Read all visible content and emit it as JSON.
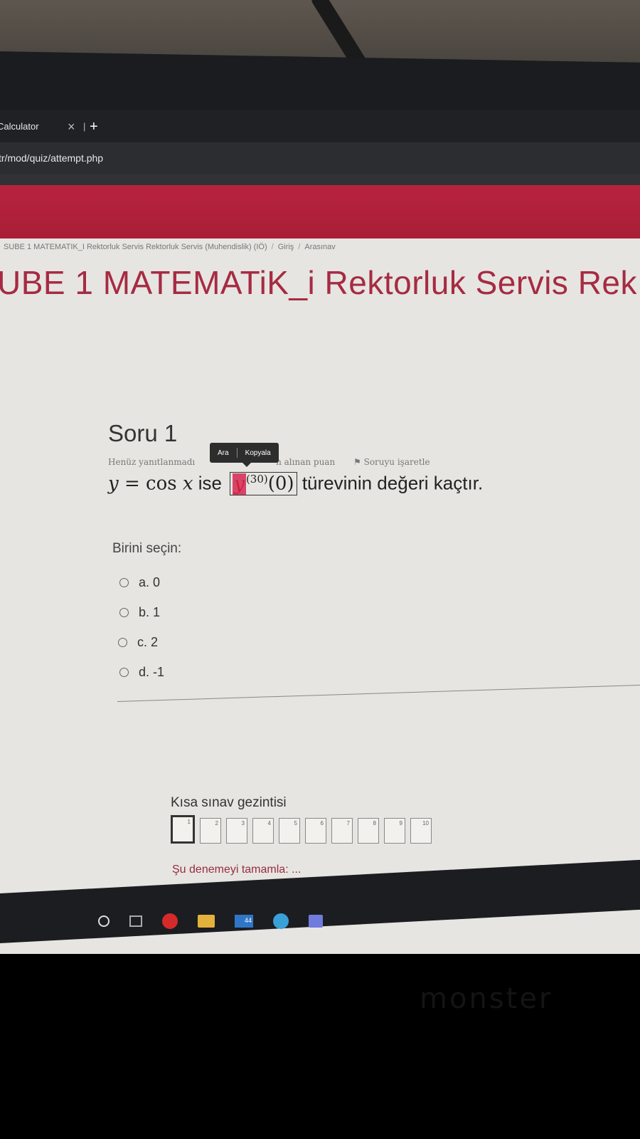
{
  "browser": {
    "tab_title": "Calculator",
    "tab_close": "×",
    "tab_separator": "|",
    "tab_new": "+",
    "url": "tr/mod/quiz/attempt.php"
  },
  "breadcrumb": [
    "SUBE 1 MATEMATIK_I Rektorluk Servis Rektorluk Servis (Muhendislik) (IÖ)",
    "Giriş",
    "Arasınav"
  ],
  "breadcrumb_separator": "/",
  "course_title": "UBE 1 MATEMATiK_i Rektorluk Servis Rek",
  "question": {
    "title": "Soru 1",
    "status": "Henüz yanıtlanmadı",
    "points_text": "n alınan puan",
    "flag_label": "Soruyu işaretle",
    "text_y": "y",
    "text_eq": "= cos",
    "text_x": "x",
    "text_ise": "ise",
    "highlight_y": "y",
    "highlight_sup": "(30)",
    "highlight_arg": "(0)",
    "text_rest": "türevinin değeri kaçtır."
  },
  "tooltip": {
    "search": "Ara",
    "copy": "Kopyala"
  },
  "choose_label": "Birini seçin:",
  "options": [
    "a. 0",
    "b. 1",
    "c. 2",
    "d. -1"
  ],
  "navigation": {
    "title": "Kısa sınav gezintisi",
    "boxes": [
      "1",
      "2",
      "3",
      "4",
      "5",
      "6",
      "7",
      "8",
      "9",
      "10"
    ],
    "finish": "Şu denemeyi tamamla: ..."
  },
  "taskbar": {
    "mail_badge": "44"
  },
  "monitor_brand": "monster"
}
